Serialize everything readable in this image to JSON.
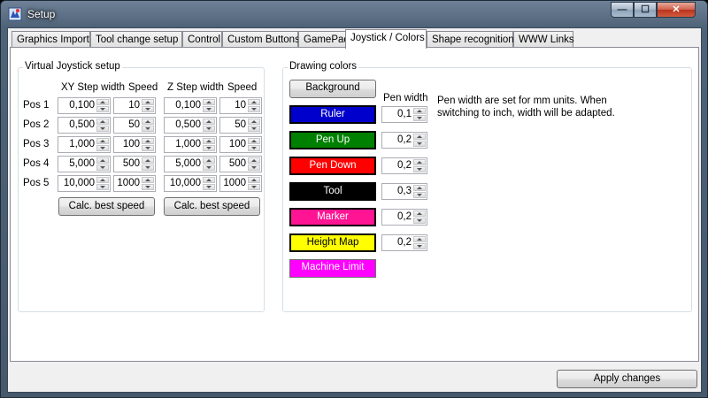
{
  "window": {
    "title": "Setup",
    "controls": {
      "minimize": "—",
      "maximize": "☐",
      "close": "✕"
    }
  },
  "tabs": [
    {
      "label": "Graphics Import"
    },
    {
      "label": "Tool change setup"
    },
    {
      "label": "Control"
    },
    {
      "label": "Custom Buttons"
    },
    {
      "label": "GamePad"
    },
    {
      "label": "Joystick / Colors",
      "active": true
    },
    {
      "label": "Shape recognition"
    },
    {
      "label": "WWW Links"
    }
  ],
  "joystick": {
    "title": "Virtual Joystick setup",
    "headers": {
      "xy_step": "XY Step width",
      "xy_speed": "Speed",
      "z_step": "Z Step width",
      "z_speed": "Speed"
    },
    "rows": [
      {
        "label": "Pos 1",
        "xy_step": "0,100",
        "xy_speed": "10",
        "z_step": "0,100",
        "z_speed": "10"
      },
      {
        "label": "Pos 2",
        "xy_step": "0,500",
        "xy_speed": "50",
        "z_step": "0,500",
        "z_speed": "50"
      },
      {
        "label": "Pos 3",
        "xy_step": "1,000",
        "xy_speed": "100",
        "z_step": "1,000",
        "z_speed": "100"
      },
      {
        "label": "Pos 4",
        "xy_step": "5,000",
        "xy_speed": "500",
        "z_step": "5,000",
        "z_speed": "500"
      },
      {
        "label": "Pos 5",
        "xy_step": "10,000",
        "xy_speed": "1000",
        "z_step": "10,000",
        "z_speed": "1000"
      }
    ],
    "calc_xy": "Calc. best speed",
    "calc_z": "Calc. best speed"
  },
  "colors": {
    "title": "Drawing colors",
    "pen_width_header": "Pen width",
    "note": "Pen width are set for mm units. When switching to inch, width will be adapted.",
    "items": [
      {
        "label": "Background",
        "bg": "#e9e9e9",
        "fg": "#000000",
        "width": null
      },
      {
        "label": "Ruler",
        "bg": "#0000cc",
        "fg": "#ffffff",
        "width": "0,1"
      },
      {
        "label": "Pen Up",
        "bg": "#008000",
        "fg": "#ffffff",
        "width": "0,2"
      },
      {
        "label": "Pen Down",
        "bg": "#ff0000",
        "fg": "#ffffff",
        "width": "0,2"
      },
      {
        "label": "Tool",
        "bg": "#000000",
        "fg": "#ffffff",
        "width": "0,3"
      },
      {
        "label": "Marker",
        "bg": "#ff1493",
        "fg": "#ffffff",
        "width": "0,2"
      },
      {
        "label": "Height Map",
        "bg": "#ffff00",
        "fg": "#000000",
        "width": "0,2"
      },
      {
        "label": "Machine Limit",
        "bg": "#ff00ff",
        "fg": "#ffffff",
        "width": null
      }
    ]
  },
  "footer": {
    "apply": "Apply changes"
  }
}
